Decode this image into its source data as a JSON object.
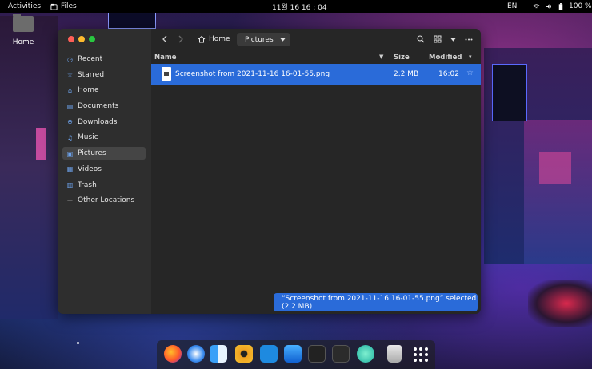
{
  "topbar": {
    "activities": "Activities",
    "app_name": "Files",
    "clock": "11월 16  16 : 04",
    "lang": "EN",
    "battery": "100 %"
  },
  "desktop": {
    "home_label": "Home"
  },
  "sidebar": {
    "items": [
      {
        "label": "Recent",
        "icon": "clock-icon"
      },
      {
        "label": "Starred",
        "icon": "star-icon"
      },
      {
        "label": "Home",
        "icon": "home-icon"
      },
      {
        "label": "Documents",
        "icon": "document-icon"
      },
      {
        "label": "Downloads",
        "icon": "download-icon"
      },
      {
        "label": "Music",
        "icon": "music-icon"
      },
      {
        "label": "Pictures",
        "icon": "picture-icon"
      },
      {
        "label": "Videos",
        "icon": "video-icon"
      },
      {
        "label": "Trash",
        "icon": "trash-icon"
      }
    ],
    "other": "Other Locations"
  },
  "header": {
    "crumb_home": "Home",
    "crumb_current": "Pictures"
  },
  "columns": {
    "name": "Name",
    "size": "Size",
    "modified": "Modified"
  },
  "files": [
    {
      "name": "Screenshot from 2021-11-16 16-01-55.png",
      "size": "2.2 MB",
      "modified": "16:02"
    }
  ],
  "status": {
    "selection": "“Screenshot from 2021-11-16 16-01-55.png” selected  (2.2 MB)"
  },
  "colors": {
    "accent": "#2a6bd9",
    "window_bg": "#252525",
    "sidebar_bg": "#2e2e2e"
  }
}
